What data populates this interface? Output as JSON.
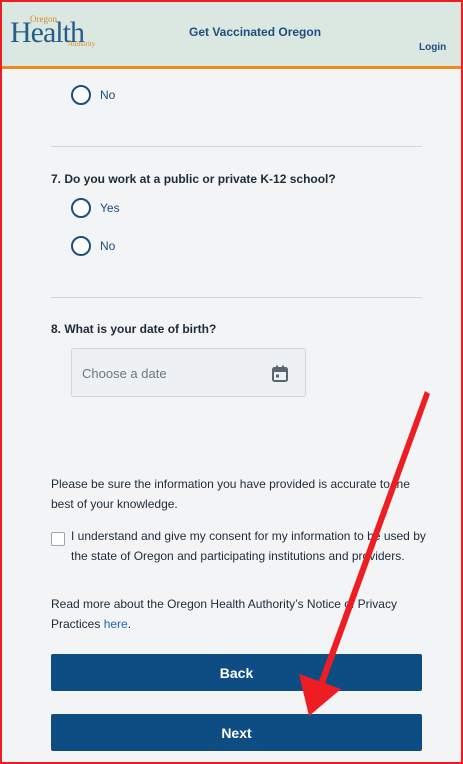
{
  "header": {
    "logo": {
      "oregon": "Oregon",
      "health": "Health",
      "authority": "Authority"
    },
    "title": "Get Vaccinated Oregon",
    "login": "Login"
  },
  "q6": {
    "option_no": "No"
  },
  "q7": {
    "question": "7. Do you work at a public or private K-12 school?",
    "option_yes": "Yes",
    "option_no": "No"
  },
  "q8": {
    "question": "8. What is your date of birth?",
    "placeholder": "Choose a date"
  },
  "notice": "Please be sure the information you have provided is accurate to the best of your knowledge.",
  "consent": "I understand and give my consent for my information to be used by the state of Oregon and participating institutions and providers.",
  "readmore": {
    "text": "Read more about the Oregon Health Authority’s Notice of Privacy Practices ",
    "link": "here",
    "end": "."
  },
  "buttons": {
    "back": "Back",
    "next": "Next"
  },
  "colors": {
    "header_bg": "#dbe8e1",
    "accent": "#f08a1c",
    "button": "#0e4d84",
    "annotation": "#ee1d23"
  }
}
